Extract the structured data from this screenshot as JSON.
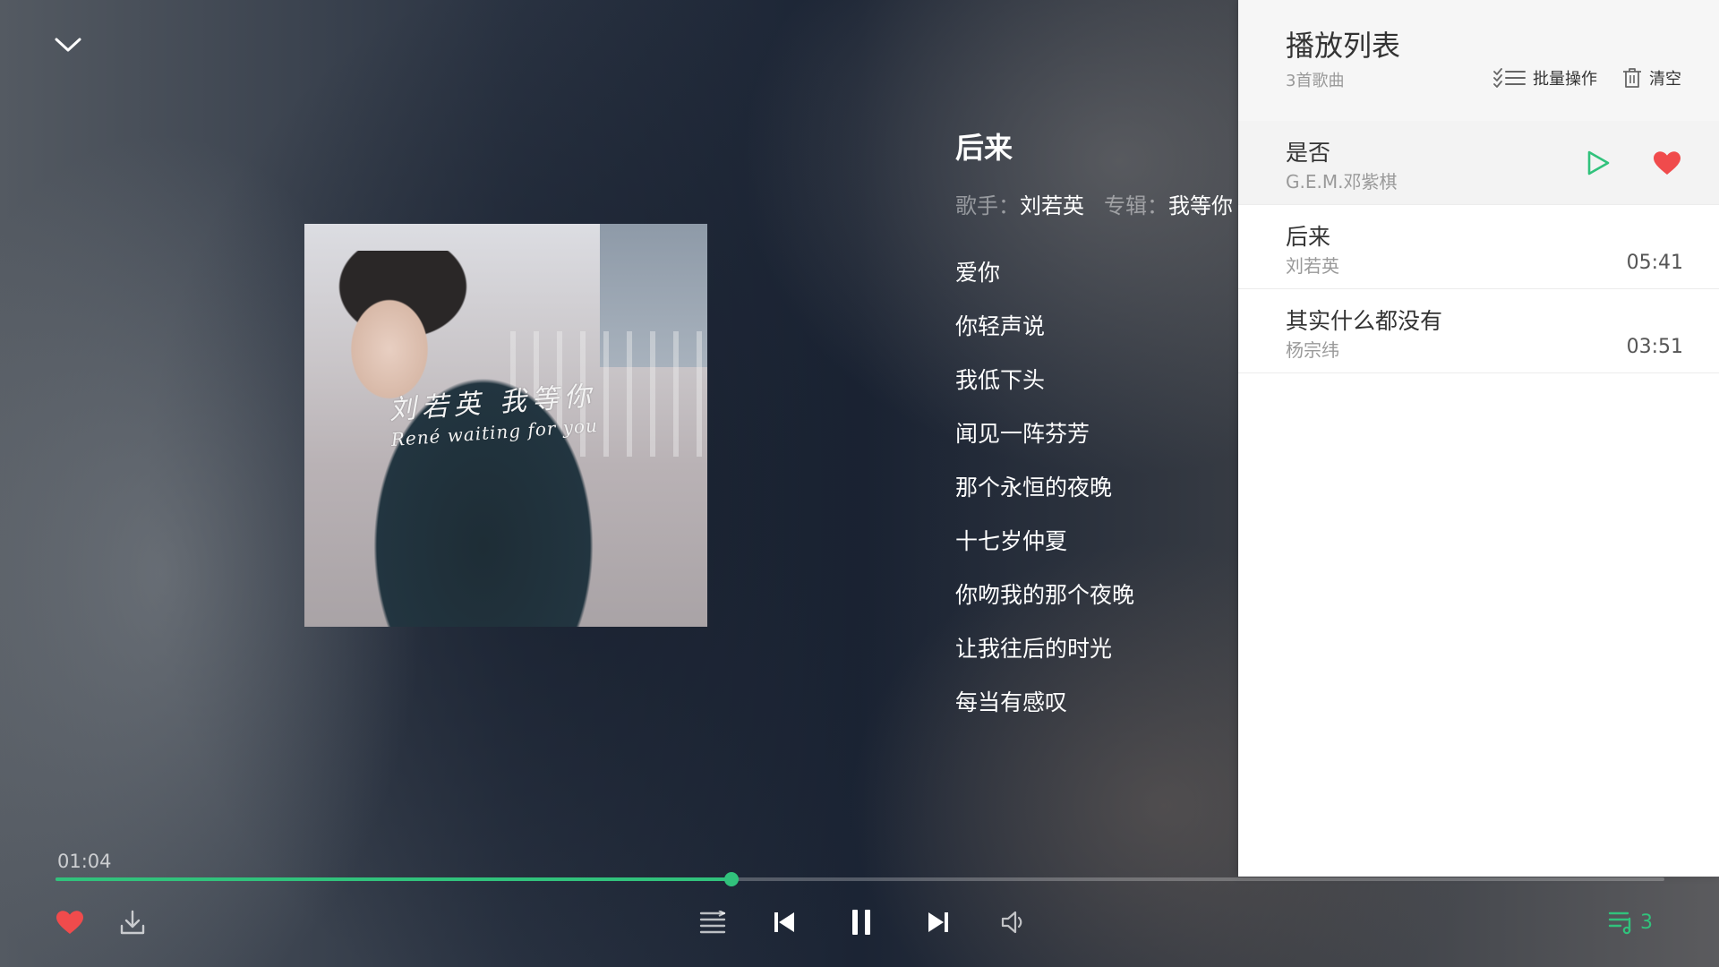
{
  "player": {
    "song_title": "后来",
    "artist_label": "歌手：",
    "artist": "刘若英",
    "album_label": "专辑：",
    "album": "我等你",
    "cover_text_line1": "刘若英 我等你",
    "cover_text_line2": "René waiting for you",
    "lyrics": [
      "爱你",
      "你轻声说",
      "我低下头",
      "闻见一阵芬芳",
      "那个永恒的夜晚",
      "十七岁仲夏",
      "你吻我的那个夜晚",
      "让我往后的时光",
      "每当有感叹"
    ],
    "current_time": "01:04",
    "progress": 0.42,
    "queue_count": "3"
  },
  "icons": {
    "collapse": "chevron-down-icon",
    "like": "heart-icon",
    "download": "download-icon",
    "mode": "list-order-icon",
    "prev": "skip-previous-icon",
    "pause": "pause-icon",
    "next": "skip-next-icon",
    "volume": "volume-icon",
    "queue": "playlist-icon",
    "batch": "batch-check-icon",
    "clear": "trash-icon",
    "play": "play-icon"
  },
  "colors": {
    "accent": "#31c27c",
    "like": "#f04b4c"
  },
  "playlist": {
    "title": "播放列表",
    "count_text": "3首歌曲",
    "batch_label": "批量操作",
    "clear_label": "清空",
    "items": [
      {
        "name": "是否",
        "artist": "G.E.M.邓紫棋",
        "duration": ""
      },
      {
        "name": "后来",
        "artist": "刘若英",
        "duration": "05:41"
      },
      {
        "name": "其实什么都没有",
        "artist": "杨宗纬",
        "duration": "03:51"
      }
    ]
  }
}
